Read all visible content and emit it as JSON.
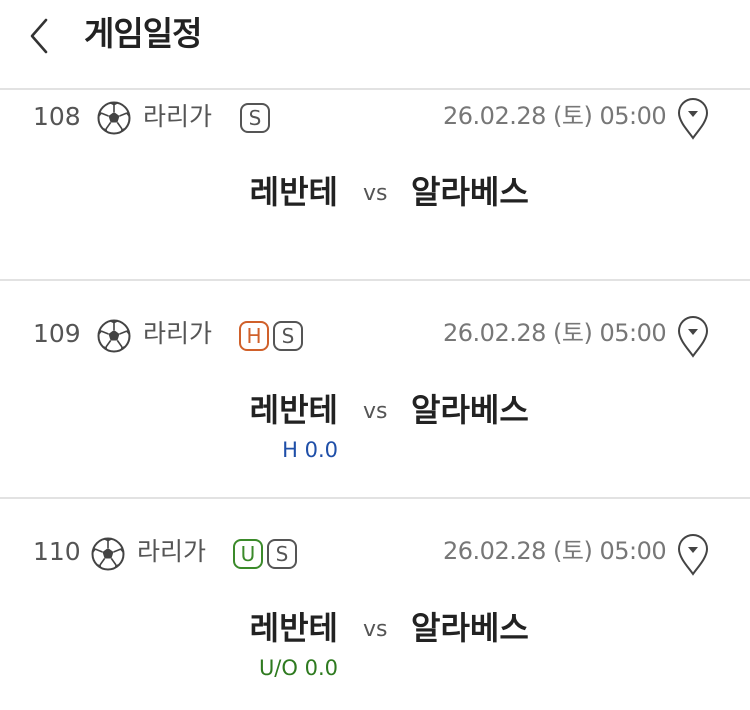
{
  "header": {
    "title": "게임일정",
    "back_icon": "chevron-left-icon"
  },
  "colors": {
    "divider": "#e2e2e2",
    "handicap_badge": "#d0602a",
    "under_over_badge": "#3b8a2a",
    "handicap_text": "#1f4fa8",
    "under_over_text": "#2e7a1f"
  },
  "games": [
    {
      "number": "108",
      "sport_icon": "soccer-ball-icon",
      "league": "라리가",
      "badges": [
        "S"
      ],
      "datetime": "26.02.28 (토) 05:00",
      "pin_icon": "location-pin-icon",
      "home": "레반테",
      "vs": "vs",
      "away": "알라베스",
      "line": ""
    },
    {
      "number": "109",
      "sport_icon": "soccer-ball-icon",
      "league": "라리가",
      "badges": [
        "H",
        "S"
      ],
      "datetime": "26.02.28 (토) 05:00",
      "pin_icon": "location-pin-icon",
      "home": "레반테",
      "vs": "vs",
      "away": "알라베스",
      "line": "H 0.0"
    },
    {
      "number": "110",
      "sport_icon": "soccer-ball-icon",
      "league": "라리가",
      "badges": [
        "U",
        "S"
      ],
      "datetime": "26.02.28 (토) 05:00",
      "pin_icon": "location-pin-icon",
      "home": "레반테",
      "vs": "vs",
      "away": "알라베스",
      "line": "U/O 0.0"
    }
  ]
}
